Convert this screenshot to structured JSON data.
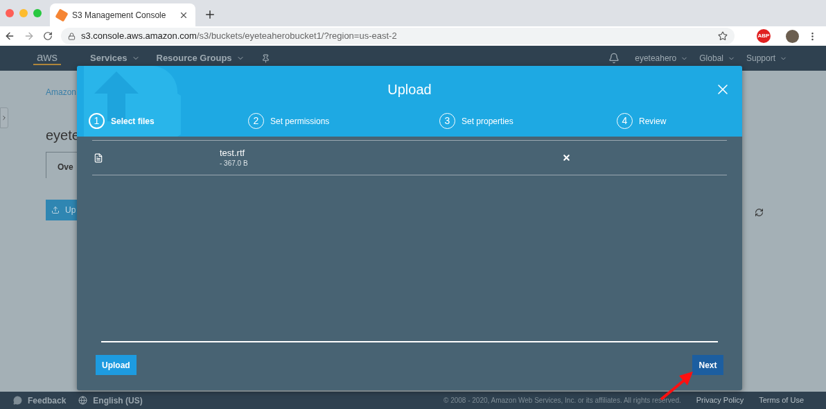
{
  "browser": {
    "tab_title": "S3 Management Console",
    "url_host": "s3.console.aws.amazon.com",
    "url_path": "/s3/buckets/eyeteaherobucket1/?region=us-east-2",
    "extension_badge": "ABP"
  },
  "nav": {
    "logo": "aws",
    "menus": [
      "Services",
      "Resource Groups"
    ],
    "right_menus": [
      "eyeteahero",
      "Global",
      "Support"
    ]
  },
  "page": {
    "breadcrumb": "Amazon",
    "heading": "eyete",
    "tab": "Ove",
    "upload_button": "Up"
  },
  "modal": {
    "title": "Upload",
    "steps": [
      {
        "number": "1",
        "label": "Select files",
        "selected": true
      },
      {
        "number": "2",
        "label": "Set permissions",
        "selected": false
      },
      {
        "number": "3",
        "label": "Set properties",
        "selected": false
      },
      {
        "number": "4",
        "label": "Review",
        "selected": false
      }
    ],
    "files": [
      {
        "name": "test.rtf",
        "size": "- 367.0 B"
      }
    ],
    "buttons": [
      {
        "label": "Upload",
        "kind": "secondary"
      },
      {
        "label": "Next",
        "kind": "primary"
      }
    ]
  },
  "footer": {
    "feedback": "Feedback",
    "language": "English (US)",
    "copyright": "© 2008 - 2020, Amazon Web Services, Inc. or its affiliates. All rights reserved.",
    "links": [
      "Privacy Policy",
      "Terms of Use"
    ]
  }
}
